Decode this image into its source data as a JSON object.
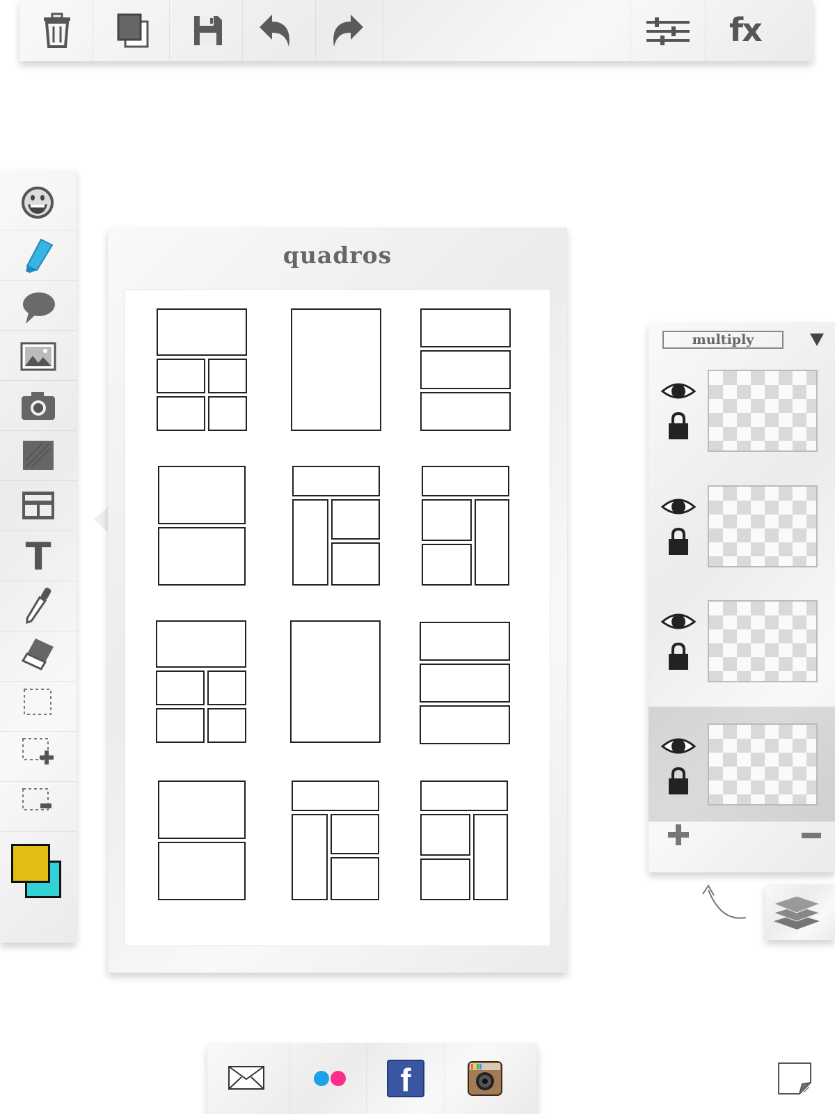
{
  "top_toolbar": {
    "left_icons": [
      "trash-icon",
      "duplicate-icon",
      "save-icon",
      "undo-icon",
      "redo-icon"
    ],
    "right_icons": [
      "adjustments-icon",
      "effects-icon"
    ],
    "fx_label": "fx"
  },
  "left_toolbar": {
    "tools": [
      "sticker-tool",
      "brush-tool",
      "speech-bubble-tool",
      "image-tool",
      "camera-tool",
      "fill-tool",
      "frames-tool",
      "text-tool",
      "eyedropper-tool",
      "eraser-tool",
      "select-tool",
      "select-add-tool",
      "select-subtract-tool"
    ],
    "primary_color": "#e0be12",
    "secondary_color": "#30d2d6",
    "text_tool_glyph": "T"
  },
  "frames_panel": {
    "title": "quadros",
    "layouts": [
      "grid-top-four",
      "single-tall",
      "three-rows",
      "two-rows",
      "header-left-tall-right-two",
      "header-left-two-right-tall",
      "grid-top-four",
      "single-tall",
      "three-rows",
      "two-rows",
      "header-left-tall-right-two",
      "header-left-two-right-tall"
    ]
  },
  "layers_panel": {
    "blend_mode": "multiply",
    "layers": [
      {
        "visible": true,
        "locked": true,
        "selected": false
      },
      {
        "visible": true,
        "locked": true,
        "selected": false
      },
      {
        "visible": true,
        "locked": true,
        "selected": false
      },
      {
        "visible": true,
        "locked": true,
        "selected": true
      }
    ],
    "add_icon": "plus-icon",
    "remove_icon": "minus-icon"
  },
  "share_bar": {
    "items": [
      "email-share",
      "flickr-share",
      "facebook-share",
      "instagram-share"
    ],
    "facebook_glyph": "f"
  },
  "colors": {
    "icon_gray": "#555555",
    "primary_swatch": "#e0be12",
    "secondary_swatch": "#30d2d6",
    "facebook_blue": "#3a56a0",
    "flickr_blue": "#1aa3e8",
    "flickr_pink": "#ff2d8a"
  }
}
